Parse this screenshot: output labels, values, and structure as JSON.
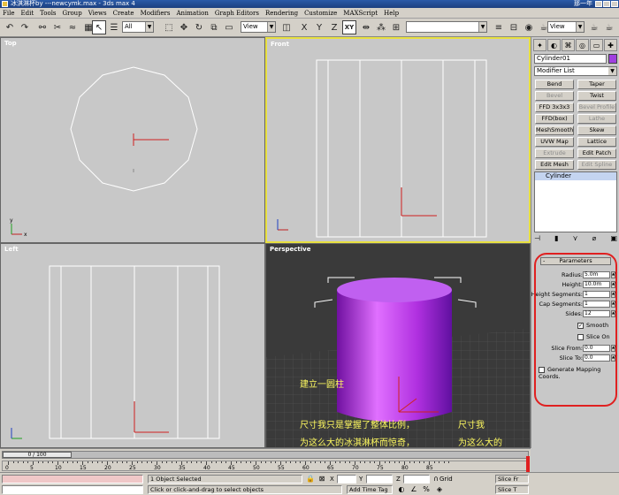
{
  "window": {
    "title": "冰淇淋杯by ---newcymk.max - 3ds max 4",
    "right_text": "那一年"
  },
  "menu": [
    "File",
    "Edit",
    "Tools",
    "Group",
    "Views",
    "Create",
    "Modifiers",
    "Animation",
    "Graph Editors",
    "Rendering",
    "Customize",
    "MAXScript",
    "Help"
  ],
  "toolbar": {
    "selection_filter": "All",
    "ref_coord": "View",
    "axis_x": "X",
    "axis_y": "Y",
    "axis_z": "Z",
    "axis_xy": "XY",
    "named_sel": "",
    "render_view": "View"
  },
  "viewports": {
    "top": "Top",
    "front": "Front",
    "left": "Left",
    "perspective": "Perspective"
  },
  "annotations": {
    "line1": "建立一圆柱",
    "line2a": "尺寸我只是掌握了整体比例，",
    "line2b": "尺寸我",
    "line3a": "为这么大的冰淇淋杯而惊奇，",
    "line3b": "为这么大的"
  },
  "command_panel": {
    "object_name": "Cylinder01",
    "object_color": "#a040e0",
    "modifier_list": "Modifier List",
    "modifiers": [
      {
        "label": "Bend",
        "enabled": true
      },
      {
        "label": "Taper",
        "enabled": true
      },
      {
        "label": "Bevel",
        "enabled": false
      },
      {
        "label": "Twist",
        "enabled": true
      },
      {
        "label": "FFD 3x3x3",
        "enabled": true
      },
      {
        "label": "Bevel Profile",
        "enabled": false
      },
      {
        "label": "FFD(box)",
        "enabled": true
      },
      {
        "label": "Lathe",
        "enabled": false
      },
      {
        "label": "MeshSmooth",
        "enabled": true
      },
      {
        "label": "Skew",
        "enabled": true
      },
      {
        "label": "UVW Map",
        "enabled": true
      },
      {
        "label": "Lattice",
        "enabled": true
      },
      {
        "label": "Extrude",
        "enabled": false
      },
      {
        "label": "Edit Patch",
        "enabled": true
      },
      {
        "label": "Edit Mesh",
        "enabled": true
      },
      {
        "label": "Edit Spline",
        "enabled": false
      }
    ],
    "stack_item": "Cylinder",
    "rollout_title": "Parameters",
    "rollout_toggle": "-",
    "params": [
      {
        "label": "Radius:",
        "value": "5.0m"
      },
      {
        "label": "Height:",
        "value": "10.0m"
      },
      {
        "label": "Height Segments:",
        "value": "1"
      },
      {
        "label": "Cap Segments:",
        "value": "1"
      },
      {
        "label": "Sides:",
        "value": "12"
      }
    ],
    "smooth_label": "Smooth",
    "slice_on_label": "Slice On",
    "slice_from_label": "Slice From:",
    "slice_from_value": "0.0",
    "slice_to_label": "Slice To:",
    "slice_to_value": "0.0",
    "gen_mapping_label": "Generate Mapping Coords."
  },
  "timeline": {
    "frame_display": "0 / 100",
    "ticks": [
      "0",
      "5",
      "10",
      "15",
      "20",
      "25",
      "30",
      "35",
      "40",
      "45",
      "50",
      "55",
      "60",
      "65",
      "70",
      "75",
      "80",
      "85"
    ]
  },
  "status": {
    "selected": "1 Object Selected",
    "prompt": "Click or click-and-drag to select objects",
    "x_label": "X",
    "y_label": "Y",
    "z_label": "Z",
    "add_time_tag": "Add Time Tag",
    "grid_label": "Grid",
    "slice_f": "Slice Fr",
    "slice_t": "Slice T"
  }
}
